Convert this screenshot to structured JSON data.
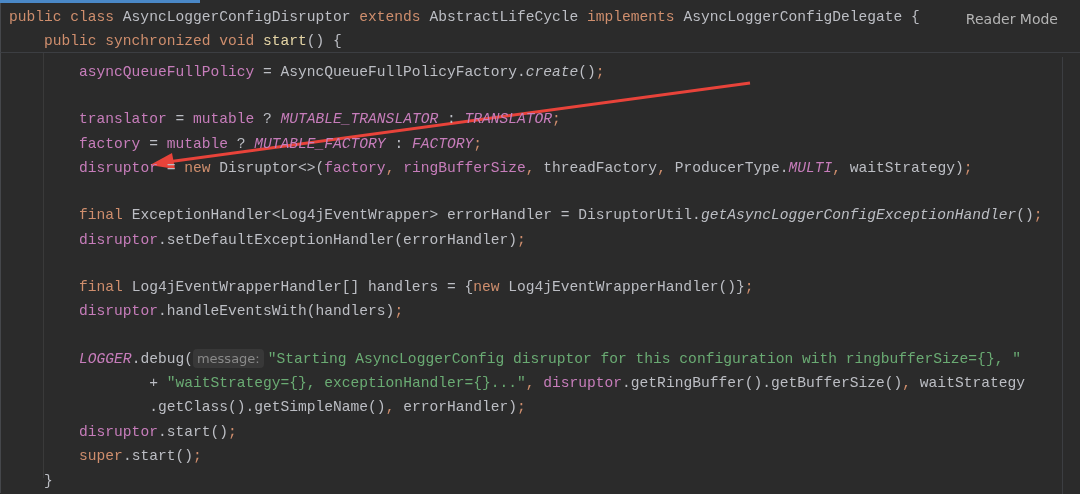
{
  "sticky_header": {
    "tokens": [
      {
        "text": "public class ",
        "kind": "kw"
      },
      {
        "text": "AsyncLoggerConfigDisruptor ",
        "kind": "plain"
      },
      {
        "text": "extends ",
        "kind": "kw"
      },
      {
        "text": "AbstractLifeCycle ",
        "kind": "plain"
      },
      {
        "text": "implements ",
        "kind": "kw"
      },
      {
        "text": "AsyncLoggerConfigDelegate {",
        "kind": "plain"
      }
    ],
    "children": [
      {
        "tokens": [
          {
            "text": "public synchronized void ",
            "kind": "kw"
          },
          {
            "text": "start",
            "kind": "decl"
          },
          {
            "text": "() {",
            "kind": "plain"
          }
        ]
      }
    ]
  },
  "reader_mode": {
    "label": "Reader Mode"
  },
  "editor_lines": [
    {
      "kind": "code",
      "tokens": [
        {
          "text": "asyncQueueFullPolicy",
          "kind": "field"
        },
        {
          "text": " = AsyncQueueFullPolicyFactory.",
          "kind": "plain"
        },
        {
          "text": "create",
          "kind": "italic"
        },
        {
          "text": "()",
          "kind": "plain"
        },
        {
          "text": ";",
          "kind": "punct"
        }
      ]
    },
    {
      "kind": "blank"
    },
    {
      "kind": "code",
      "tokens": [
        {
          "text": "translator",
          "kind": "field"
        },
        {
          "text": " = ",
          "kind": "plain"
        },
        {
          "text": "mutable",
          "kind": "field"
        },
        {
          "text": " ? ",
          "kind": "plain"
        },
        {
          "text": "MUTABLE_TRANSLATOR",
          "kind": "const"
        },
        {
          "text": " : ",
          "kind": "plain"
        },
        {
          "text": "TRANSLATOR",
          "kind": "const"
        },
        {
          "text": ";",
          "kind": "punct"
        }
      ]
    },
    {
      "kind": "code",
      "tokens": [
        {
          "text": "factory",
          "kind": "field"
        },
        {
          "text": " = ",
          "kind": "plain"
        },
        {
          "text": "mutable",
          "kind": "field"
        },
        {
          "text": " ? ",
          "kind": "plain"
        },
        {
          "text": "MUTABLE_FACTORY",
          "kind": "const"
        },
        {
          "text": " : ",
          "kind": "plain"
        },
        {
          "text": "FACTORY",
          "kind": "const"
        },
        {
          "text": ";",
          "kind": "punct"
        }
      ]
    },
    {
      "kind": "code",
      "tokens": [
        {
          "text": "disruptor",
          "kind": "field"
        },
        {
          "text": " = ",
          "kind": "plain"
        },
        {
          "text": "new ",
          "kind": "kw"
        },
        {
          "text": "Disruptor<>(",
          "kind": "plain"
        },
        {
          "text": "factory",
          "kind": "field"
        },
        {
          "text": ", ",
          "kind": "punct"
        },
        {
          "text": "ringBufferSize",
          "kind": "field"
        },
        {
          "text": ", ",
          "kind": "punct"
        },
        {
          "text": "threadFactory",
          "kind": "plain"
        },
        {
          "text": ", ",
          "kind": "punct"
        },
        {
          "text": "ProducerType.",
          "kind": "plain"
        },
        {
          "text": "MULTI",
          "kind": "const"
        },
        {
          "text": ", ",
          "kind": "punct"
        },
        {
          "text": "waitStrategy)",
          "kind": "plain"
        },
        {
          "text": ";",
          "kind": "punct"
        }
      ]
    },
    {
      "kind": "blank"
    },
    {
      "kind": "code",
      "tokens": [
        {
          "text": "final ",
          "kind": "kw"
        },
        {
          "text": "ExceptionHandler<Log4jEventWrapper> errorHandler = DisruptorUtil.",
          "kind": "plain"
        },
        {
          "text": "getAsyncLoggerConfigExceptionHandler",
          "kind": "italic"
        },
        {
          "text": "()",
          "kind": "plain"
        },
        {
          "text": ";",
          "kind": "punct"
        }
      ]
    },
    {
      "kind": "code",
      "tokens": [
        {
          "text": "disruptor",
          "kind": "field"
        },
        {
          "text": ".setDefaultExceptionHandler(errorHandler)",
          "kind": "plain"
        },
        {
          "text": ";",
          "kind": "punct"
        }
      ]
    },
    {
      "kind": "blank"
    },
    {
      "kind": "code",
      "tokens": [
        {
          "text": "final ",
          "kind": "kw"
        },
        {
          "text": "Log4jEventWrapperHandler[] handlers = {",
          "kind": "plain"
        },
        {
          "text": "new ",
          "kind": "kw"
        },
        {
          "text": "Log4jEventWrapperHandler()}",
          "kind": "plain"
        },
        {
          "text": ";",
          "kind": "punct"
        }
      ]
    },
    {
      "kind": "code",
      "tokens": [
        {
          "text": "disruptor",
          "kind": "field"
        },
        {
          "text": ".handleEventsWith(handlers)",
          "kind": "plain"
        },
        {
          "text": ";",
          "kind": "punct"
        }
      ]
    },
    {
      "kind": "blank"
    },
    {
      "kind": "code",
      "tokens": [
        {
          "text": "LOGGER",
          "kind": "const"
        },
        {
          "text": ".debug(",
          "kind": "plain"
        },
        {
          "text": "message:",
          "kind": "hint"
        },
        {
          "text": "\"Starting AsyncLoggerConfig disruptor for this configuration with ringbufferSize={}, \"",
          "kind": "str"
        }
      ],
      "children": [
        {
          "tokens": [
            {
              "text": "+ ",
              "kind": "plain"
            },
            {
              "text": "\"waitStrategy={}, exceptionHandler={}...\"",
              "kind": "str"
            },
            {
              "text": ", ",
              "kind": "punct"
            },
            {
              "text": "disruptor",
              "kind": "field"
            },
            {
              "text": ".getRingBuffer().getBufferSize()",
              "kind": "plain"
            },
            {
              "text": ", ",
              "kind": "punct"
            },
            {
              "text": "waitStrategy",
              "kind": "plain"
            }
          ]
        },
        {
          "tokens": [
            {
              "text": ".getClass().getSimpleName()",
              "kind": "plain"
            },
            {
              "text": ", ",
              "kind": "punct"
            },
            {
              "text": "errorHandler)",
              "kind": "plain"
            },
            {
              "text": ";",
              "kind": "punct"
            }
          ]
        }
      ]
    },
    {
      "kind": "code",
      "tokens": [
        {
          "text": "disruptor",
          "kind": "field"
        },
        {
          "text": ".start()",
          "kind": "plain"
        },
        {
          "text": ";",
          "kind": "punct"
        }
      ]
    },
    {
      "kind": "code",
      "tokens": [
        {
          "text": "super",
          "kind": "kw"
        },
        {
          "text": ".start()",
          "kind": "plain"
        },
        {
          "text": ";",
          "kind": "punct"
        }
      ]
    }
  ],
  "closing_line": {
    "tokens": [
      {
        "text": "}",
        "kind": "plain"
      }
    ]
  }
}
